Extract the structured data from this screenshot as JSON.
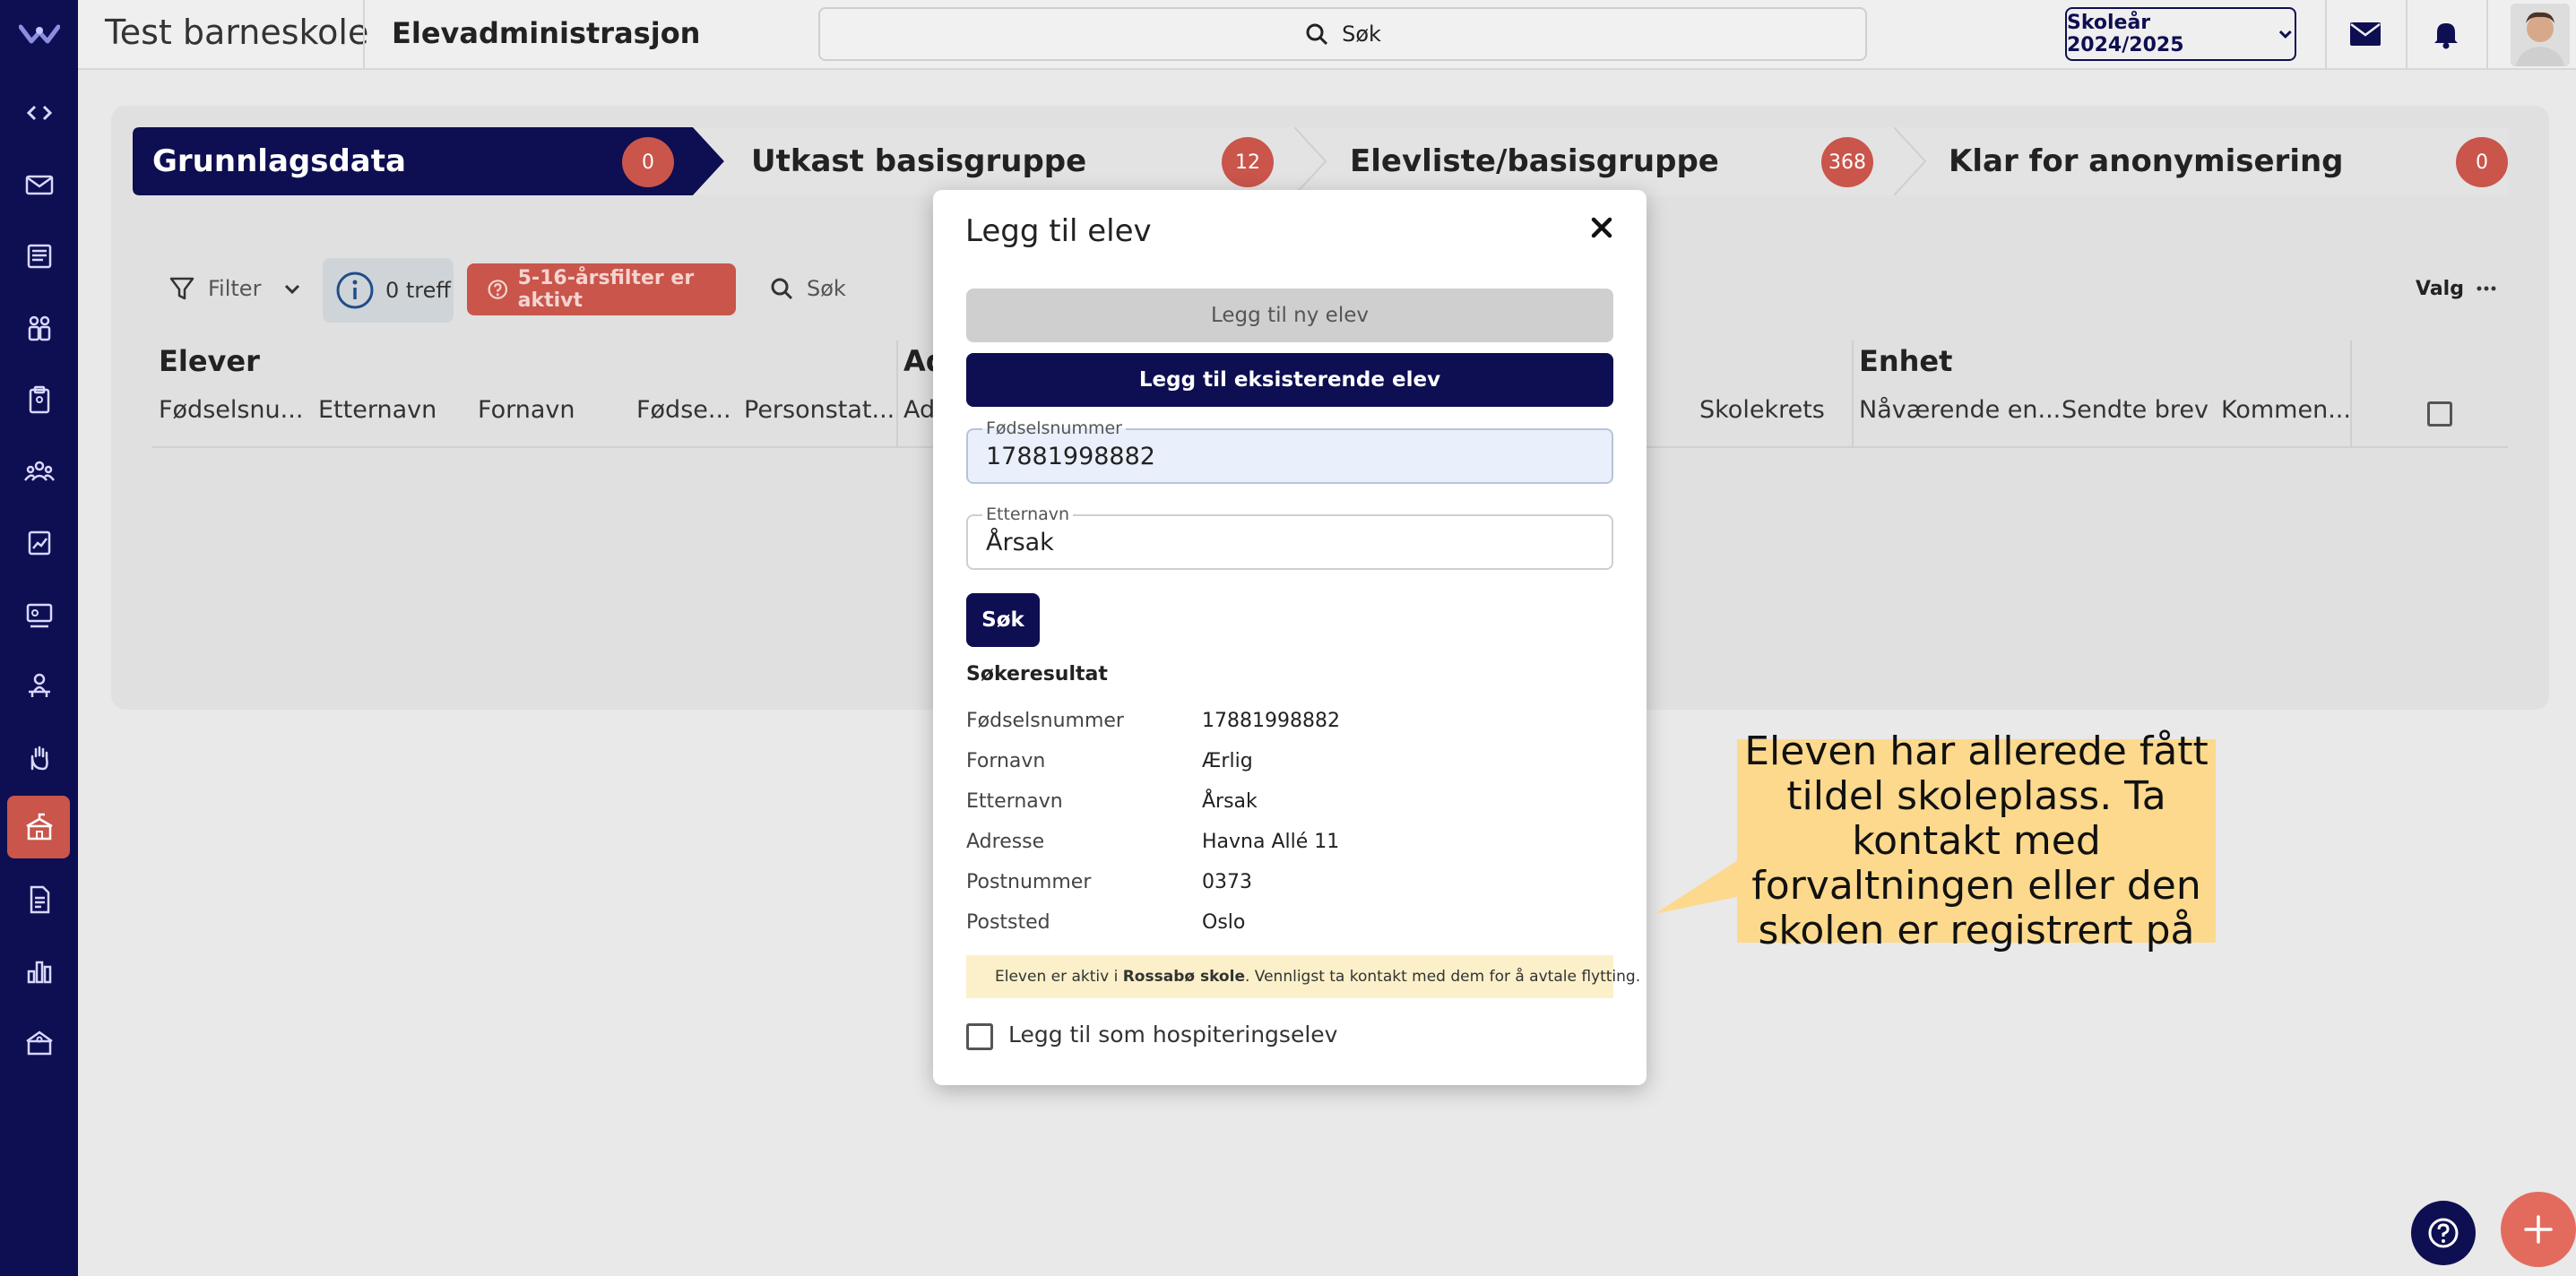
{
  "topbar": {
    "school_name": "Test barneskole",
    "module_name": "Elevadministrasjon",
    "search_label": "Søk",
    "school_year": "Skoleår 2024/2025"
  },
  "sidebar": {
    "icons": [
      "code-icon",
      "mail-icon",
      "news-icon",
      "people-icon",
      "clipboard-icon",
      "group-icon",
      "chart-board-icon",
      "presentation-icon",
      "person-desk-icon",
      "hand-icon",
      "school-icon",
      "document-icon",
      "bar-chart-icon",
      "building-icon"
    ],
    "active": "school-icon"
  },
  "steps": [
    {
      "label": "Grunnlagsdata",
      "count": "0"
    },
    {
      "label": "Utkast basisgruppe",
      "count": "12"
    },
    {
      "label": "Elevliste/basisgruppe",
      "count": "368"
    },
    {
      "label": "Klar for anonymisering",
      "count": "0"
    }
  ],
  "toolbar": {
    "filter_label": "Filter",
    "treff_label": "0 treff",
    "age_filter_label": "5-16-årsfilter er aktivt",
    "search_label": "Søk",
    "options_label": "Valg"
  },
  "table": {
    "groups": {
      "elever": "Elever",
      "adresse": "Ad",
      "enhet": "Enhet"
    },
    "columns": {
      "fodselsnummer": "Fødselsnu...",
      "etternavn": "Etternavn",
      "fornavn": "Fornavn",
      "fodsel": "Fødse...",
      "personstatus": "Personstat...",
      "adresse": "Ad",
      "skolekrets": "Skolekrets",
      "navaerende": "Nåværende en...",
      "sendte_brev": "Sendte brev",
      "kommentar": "Kommen..."
    }
  },
  "modal": {
    "title": "Legg til elev",
    "btn_new": "Legg til ny elev",
    "btn_existing": "Legg til eksisterende elev",
    "fodselsnummer_label": "Fødselsnummer",
    "fodselsnummer_value": "17881998882",
    "etternavn_label": "Etternavn",
    "etternavn_value": "Årsak",
    "search_button": "Søk",
    "result_title": "Søkeresultat",
    "results": [
      {
        "label": "Fødselsnummer",
        "value": "17881998882"
      },
      {
        "label": "Fornavn",
        "value": "Ærlig"
      },
      {
        "label": "Etternavn",
        "value": "Årsak"
      },
      {
        "label": "Adresse",
        "value": "Havna Allé 11"
      },
      {
        "label": "Postnummer",
        "value": "0373"
      },
      {
        "label": "Poststed",
        "value": "Oslo"
      }
    ],
    "info_prefix": "Eleven er aktiv i ",
    "info_school": "Rossabø skole",
    "info_suffix": ". Vennligst ta kontakt med dem for å avtale flytting.",
    "hosp_label": "Legg til som hospiteringselev"
  },
  "callout": {
    "text": "Eleven har allerede fått tildel skoleplass. Ta kontakt med forvaltningen eller den skolen er registrert på"
  },
  "colors": {
    "navy": "#0e0e52",
    "accent_red": "#c9554b",
    "callout_yellow": "#fcd98c",
    "info_yellow": "#fbf0c9"
  }
}
